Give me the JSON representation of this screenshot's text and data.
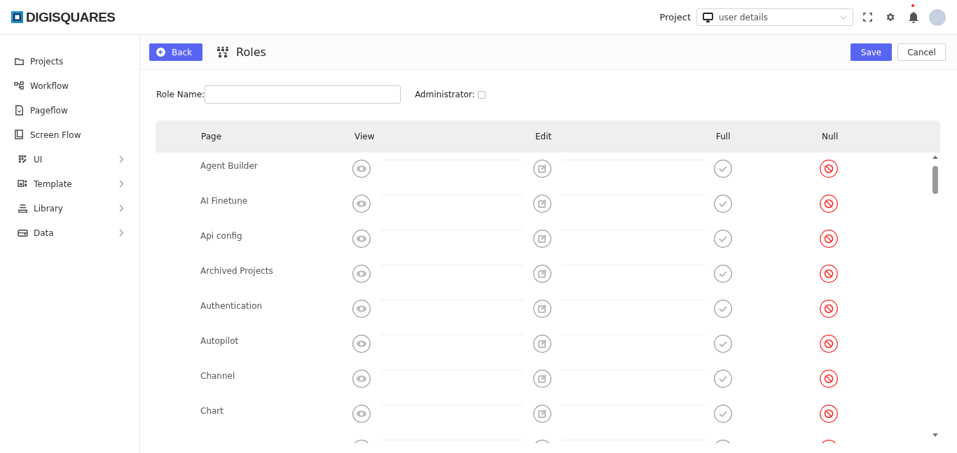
{
  "brand": "DIGISQUARES",
  "project": {
    "label": "Project",
    "value": "user details"
  },
  "notifications": {
    "unread": true
  },
  "sidebar": {
    "items": [
      {
        "label": "Projects",
        "kind": "page"
      },
      {
        "label": "Workflow",
        "kind": "page"
      },
      {
        "label": "Pageflow",
        "kind": "page"
      },
      {
        "label": "Screen Flow",
        "kind": "page"
      },
      {
        "label": "UI",
        "kind": "group",
        "expanded": false
      },
      {
        "label": "Template",
        "kind": "group",
        "expanded": false
      },
      {
        "label": "Library",
        "kind": "group",
        "expanded": false
      },
      {
        "label": "Data",
        "kind": "group",
        "expanded": false
      }
    ]
  },
  "toolbar": {
    "back": "Back",
    "title": "Roles",
    "save": "Save",
    "cancel": "Cancel"
  },
  "form": {
    "role_name_label": "Role Name:",
    "administrator_label": "Administrator:",
    "administrator_checked": false
  },
  "table": {
    "columns": [
      "Page",
      "View",
      "Edit",
      "Full",
      "Null"
    ],
    "rows": [
      {
        "page": "Agent Builder",
        "view": false,
        "edit": false,
        "full": false,
        "null": true
      },
      {
        "page": "AI Finetune",
        "view": false,
        "edit": false,
        "full": false,
        "null": true
      },
      {
        "page": "Api config",
        "view": false,
        "edit": false,
        "full": false,
        "null": true
      },
      {
        "page": "Archived Projects",
        "view": false,
        "edit": false,
        "full": false,
        "null": true
      },
      {
        "page": "Authentication",
        "view": false,
        "edit": false,
        "full": false,
        "null": true
      },
      {
        "page": "Autopilot",
        "view": false,
        "edit": false,
        "full": false,
        "null": true
      },
      {
        "page": "Channel",
        "view": false,
        "edit": false,
        "full": false,
        "null": true
      },
      {
        "page": "Chart",
        "view": false,
        "edit": false,
        "full": false,
        "null": true
      },
      {
        "view": false,
        "edit": false,
        "full": false,
        "null": true
      }
    ]
  }
}
